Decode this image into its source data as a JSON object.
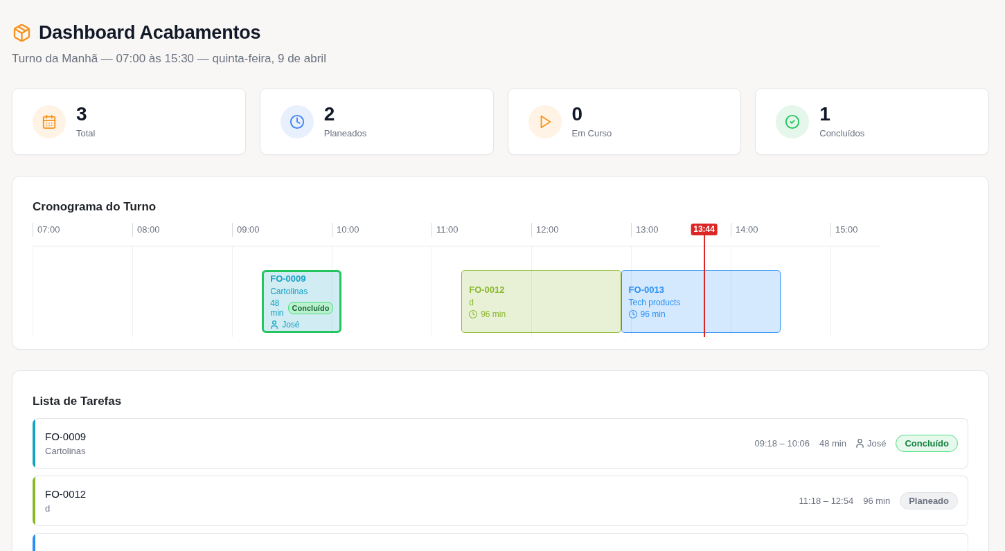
{
  "header": {
    "title": "Dashboard Acabamentos",
    "subtitle": "Turno da Manhã — 07:00 às 15:30 — quinta-feira, 9 de abril"
  },
  "stats": [
    {
      "kind": "total",
      "value": "3",
      "label": "Total"
    },
    {
      "kind": "planned",
      "value": "2",
      "label": "Planeados"
    },
    {
      "kind": "running",
      "value": "0",
      "label": "Em Curso"
    },
    {
      "kind": "done",
      "value": "1",
      "label": "Concluídos"
    }
  ],
  "timeline": {
    "title": "Cronograma do Turno",
    "ticks": [
      "07:00",
      "08:00",
      "09:00",
      "10:00",
      "11:00",
      "12:00",
      "13:00",
      "14:00",
      "15:00"
    ],
    "now": "13:44",
    "blocks": [
      {
        "code": "FO-0009",
        "description": "Cartolinas",
        "duration": "48 min",
        "assignee": "José",
        "status": {
          "label": "Concluído",
          "kind": "done"
        },
        "color": "#17a2c4"
      },
      {
        "code": "FO-0012",
        "description": "d",
        "duration": "96 min",
        "color": "#8ab82d"
      },
      {
        "code": "FO-0013",
        "description": "Tech products",
        "duration": "96 min",
        "color": "#2a8ff5"
      }
    ]
  },
  "tasks": {
    "title": "Lista de Tarefas",
    "items": [
      {
        "code": "FO-0009",
        "description": "Cartolinas",
        "time_range": "09:18 – 10:06",
        "duration": "48 min",
        "assignee": "José",
        "status": {
          "label": "Concluído",
          "kind": "done"
        },
        "color": "#17a2c4"
      },
      {
        "code": "FO-0012",
        "description": "d",
        "time_range": "11:18 – 12:54",
        "duration": "96 min",
        "status": {
          "label": "Planeado",
          "kind": "planned"
        },
        "color": "#8ab82d"
      },
      {
        "color": "#2a8ff5"
      }
    ]
  }
}
